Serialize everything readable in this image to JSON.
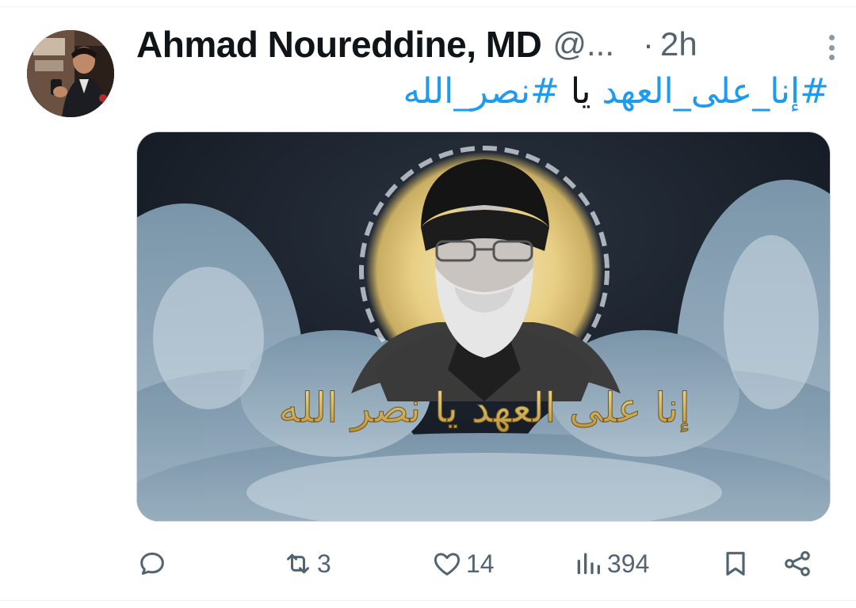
{
  "tweet": {
    "author": {
      "display_name": "Ahmad Noureddine, MD",
      "handle": "@...",
      "avatar_icon": "user-avatar"
    },
    "separator": "·",
    "time": "2h",
    "text": {
      "hashtag_1": "#إنا_على_العهد",
      "middle": " يا ",
      "hashtag_2": "#نصر_الله"
    },
    "media": {
      "calligraphy": "إنا على العهد يا نصر الله"
    },
    "actions": {
      "replies": "",
      "retweets": "3",
      "likes": "14",
      "views": "394"
    }
  },
  "colors": {
    "accent": "#1d9bf0",
    "muted": "#536471",
    "text": "#0f1419",
    "gold": "#d9b650"
  }
}
